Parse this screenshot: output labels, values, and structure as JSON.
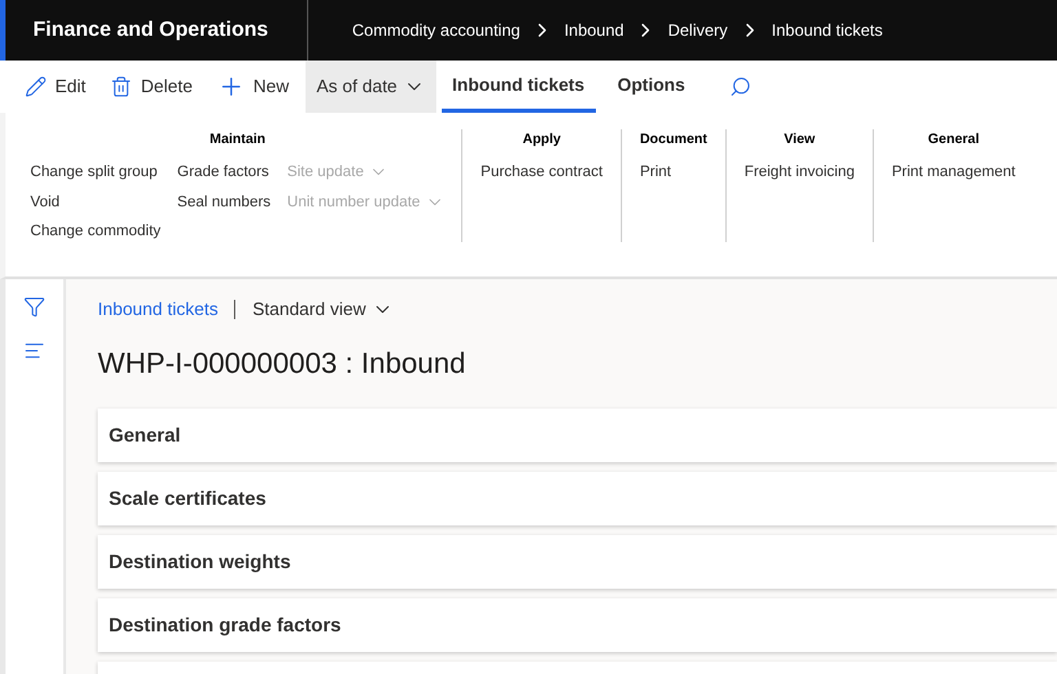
{
  "app_title": "Finance and Operations",
  "breadcrumb": [
    "Commodity accounting",
    "Inbound",
    "Delivery",
    "Inbound tickets"
  ],
  "actions": [
    {
      "kind": "edit",
      "label": "Edit"
    },
    {
      "kind": "delete",
      "label": "Delete"
    },
    {
      "kind": "new",
      "label": "New"
    },
    {
      "kind": "dropdown",
      "label": "As of date",
      "highlighted": true
    }
  ],
  "tabs": [
    {
      "label": "Inbound tickets",
      "selected": true
    },
    {
      "label": "Options",
      "selected": false
    }
  ],
  "ribbon_groups": [
    {
      "title": "Maintain",
      "columns": [
        [
          {
            "label": "Change split group",
            "disabled": false,
            "dropdown": false
          },
          {
            "label": "Void",
            "disabled": false,
            "dropdown": false
          },
          {
            "label": "Change commodity",
            "disabled": false,
            "dropdown": false
          }
        ],
        [
          {
            "label": "Grade factors",
            "disabled": false,
            "dropdown": false
          },
          {
            "label": "Seal numbers",
            "disabled": false,
            "dropdown": false
          }
        ],
        [
          {
            "label": "Site update",
            "disabled": true,
            "dropdown": true
          },
          {
            "label": "Unit number update",
            "disabled": true,
            "dropdown": true
          }
        ]
      ]
    },
    {
      "title": "Apply",
      "columns": [
        [
          {
            "label": "Purchase contract",
            "disabled": false,
            "dropdown": false
          }
        ]
      ]
    },
    {
      "title": "Document",
      "columns": [
        [
          {
            "label": "Print",
            "disabled": false,
            "dropdown": false
          }
        ]
      ]
    },
    {
      "title": "View",
      "columns": [
        [
          {
            "label": "Freight invoicing",
            "disabled": false,
            "dropdown": false
          }
        ]
      ]
    },
    {
      "title": "General",
      "columns": [
        [
          {
            "label": "Print management",
            "disabled": false,
            "dropdown": false
          }
        ]
      ]
    }
  ],
  "page": {
    "breadcrumb_link": "Inbound tickets",
    "view": "Standard view",
    "title": "WHP-I-000000003 : Inbound"
  },
  "sections": [
    {
      "title": "General"
    },
    {
      "title": "Scale certificates"
    },
    {
      "title": "Destination weights"
    },
    {
      "title": "Destination grade factors"
    }
  ],
  "more_sections_below": true
}
